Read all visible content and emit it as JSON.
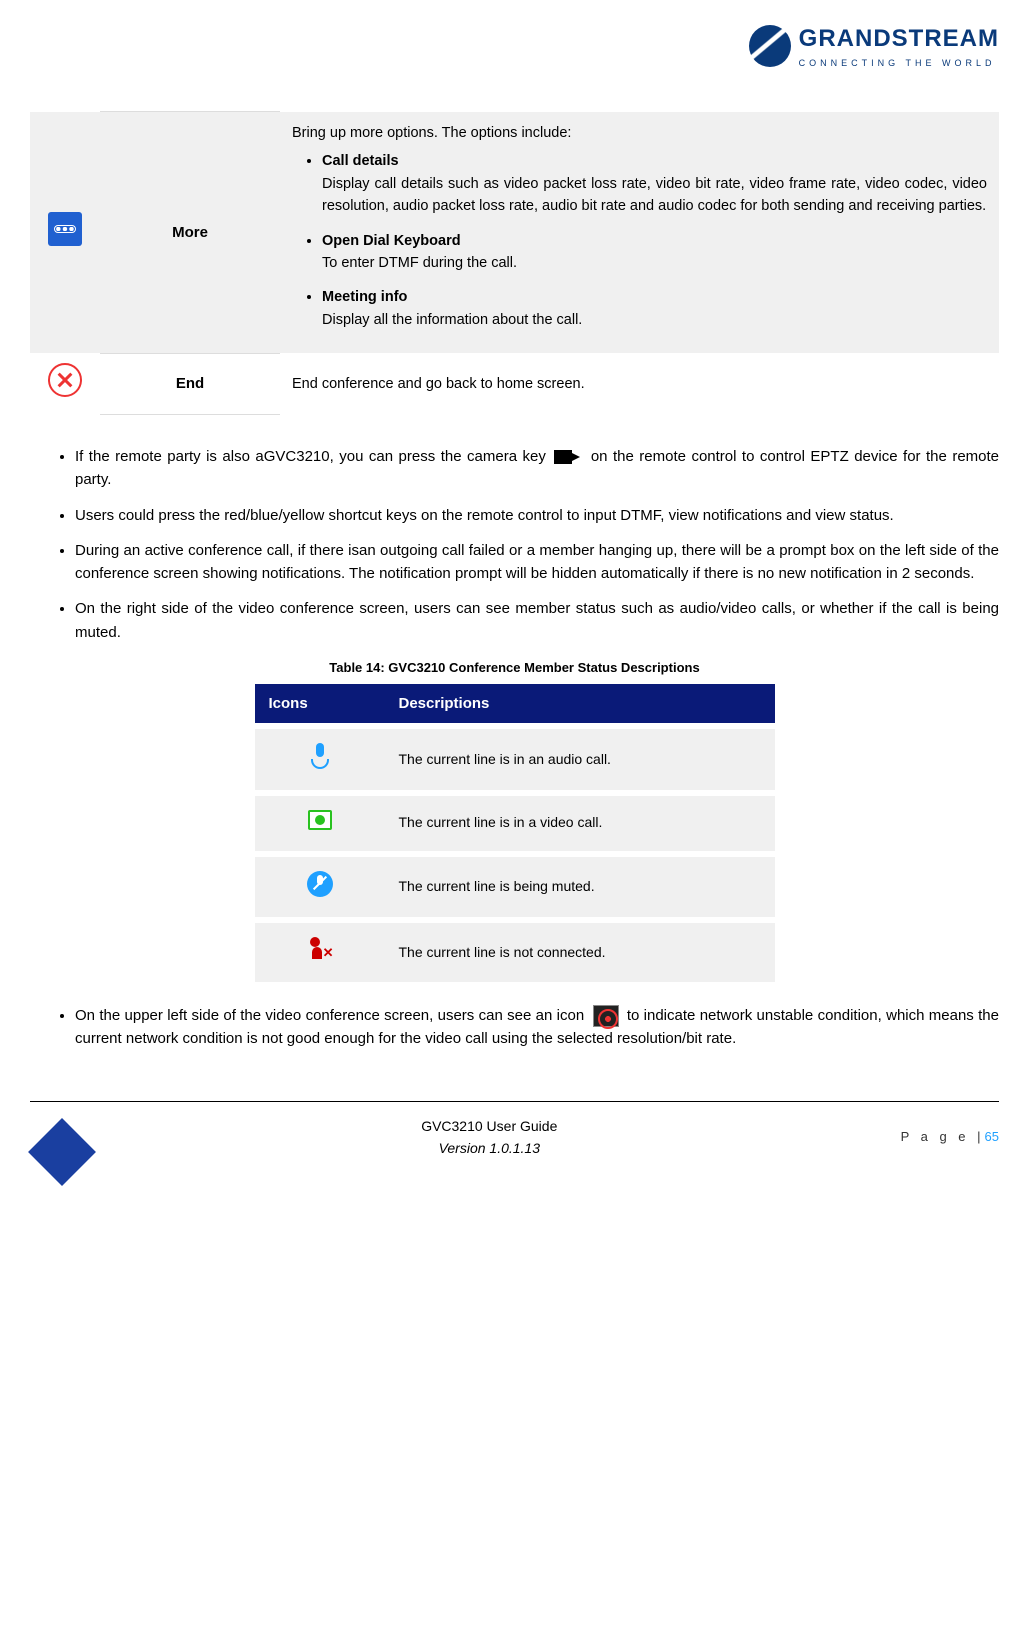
{
  "brand": {
    "name": "GRANDSTREAM",
    "tagline": "CONNECTING THE WORLD"
  },
  "options_table": {
    "rows": [
      {
        "icon": "more-icon",
        "label": "More",
        "intro": "Bring up more options. The options include:",
        "items": [
          {
            "title": "Call details",
            "desc": "Display call details such as video packet loss rate, video bit rate, video frame rate, video codec, video resolution, audio packet loss rate, audio bit rate and audio codec for both sending and receiving parties."
          },
          {
            "title": "Open Dial Keyboard",
            "desc": "To enter DTMF during the call."
          },
          {
            "title": "Meeting info",
            "desc": "Display all the information about the call."
          }
        ]
      },
      {
        "icon": "end-icon",
        "label": "End",
        "text": "End conference and go back to home screen."
      }
    ]
  },
  "bullets": {
    "b1a": "If the remote party is also aGVC3210, you can press the camera key ",
    "b1b": " on the remote control to control EPTZ device for the remote party.",
    "b2": "Users could press the red/blue/yellow shortcut keys on the remote control to input DTMF, view notifications and view status.",
    "b3": "During an active conference call, if there isan outgoing call failed or a member hanging up, there will be a prompt box on the left side of the conference screen showing notifications. The notification prompt will be hidden automatically if there is no new notification in 2 seconds.",
    "b4": "On the right side of the video conference screen, users can see member status such as audio/video calls, or whether if the call is being muted.",
    "b5a": "On the upper left side of the video conference screen, users can see an icon ",
    "b5b": " to indicate network unstable condition, which means the current network condition is not good enough for the video call using the selected resolution/bit rate."
  },
  "status_table": {
    "caption": "Table 14: GVC3210 Conference Member Status Descriptions",
    "headers": {
      "icons": "Icons",
      "desc": "Descriptions"
    },
    "rows": [
      {
        "icon": "mic-icon",
        "desc": "The current line is in an audio call."
      },
      {
        "icon": "vid-icon",
        "desc": "The current line is in a video call."
      },
      {
        "icon": "mute-icon",
        "desc": "The current line is being muted."
      },
      {
        "icon": "disc-icon",
        "desc": "The current line is not connected."
      }
    ]
  },
  "footer": {
    "title": "GVC3210 User Guide",
    "version": "Version 1.0.1.13",
    "page_label": "P a g e  |",
    "page_num": "65"
  }
}
